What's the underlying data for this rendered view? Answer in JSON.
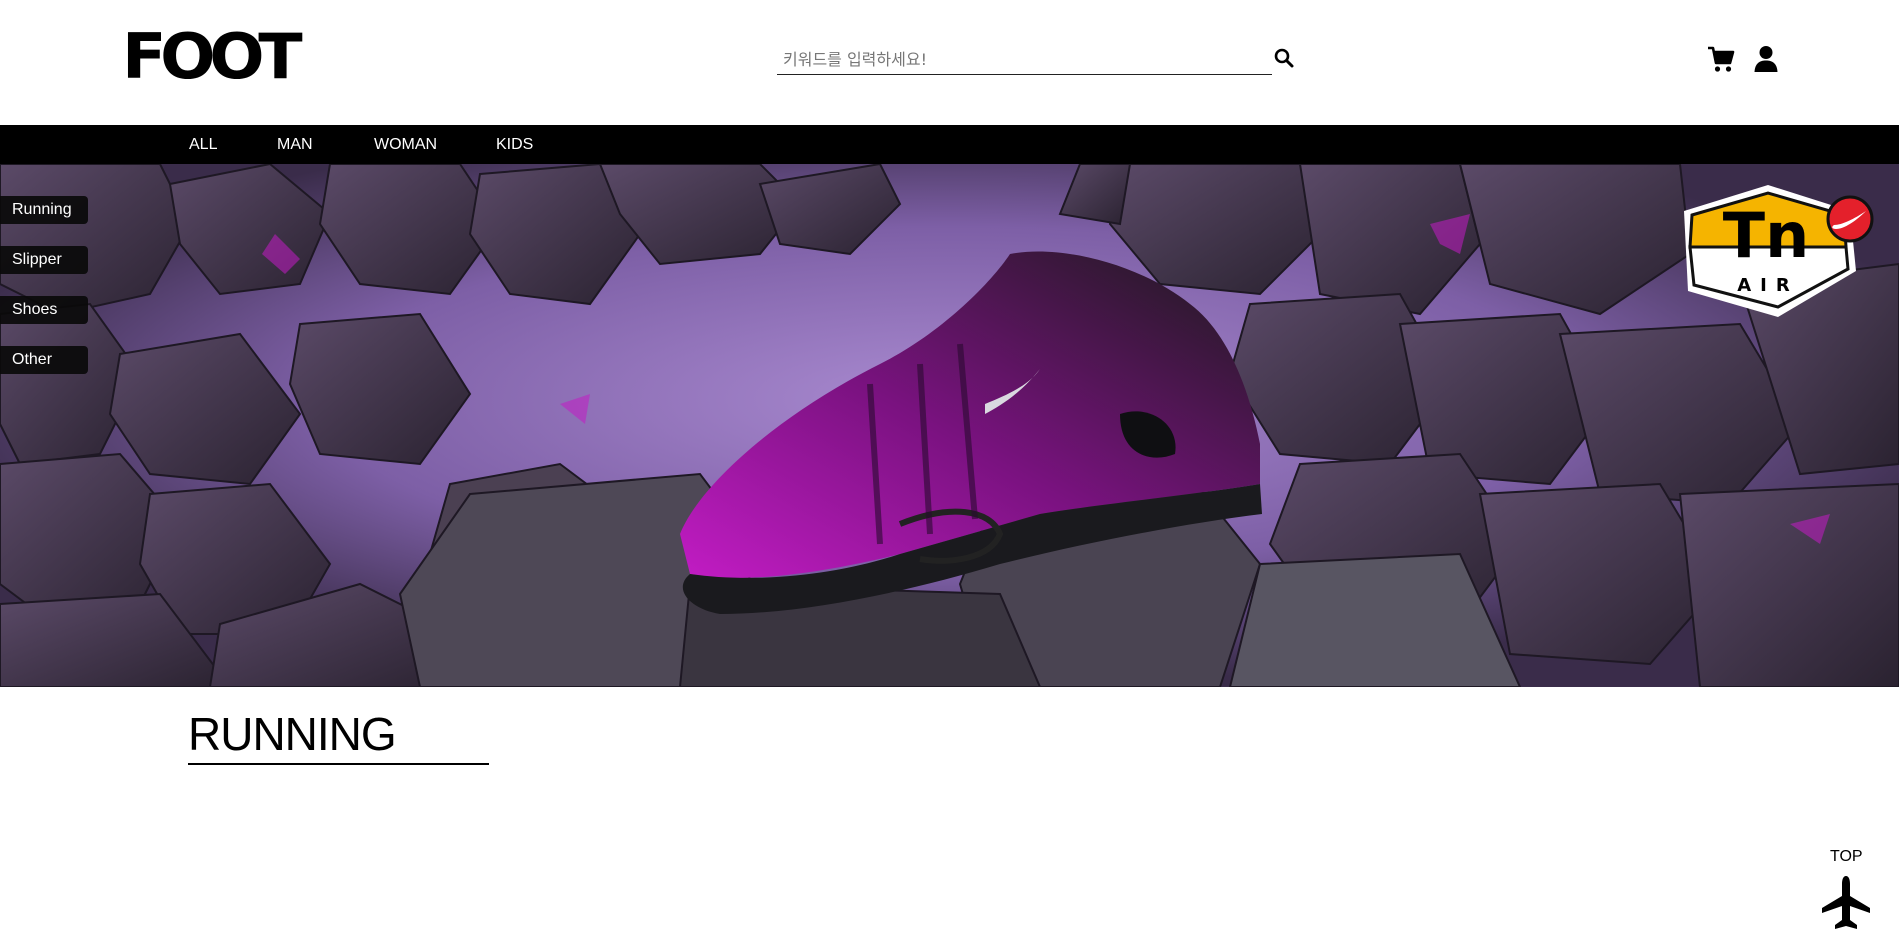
{
  "header": {
    "logo_text": "FOOT",
    "search": {
      "placeholder": "키워드를 입력하세요!",
      "value": ""
    },
    "icons": [
      "search-icon",
      "cart-icon",
      "user-icon"
    ]
  },
  "nav": {
    "items": [
      {
        "label": "ALL"
      },
      {
        "label": "MAN"
      },
      {
        "label": "WOMAN"
      },
      {
        "label": "KIDS"
      }
    ]
  },
  "side_menu": {
    "items": [
      {
        "label": "Running"
      },
      {
        "label": "Slipper"
      },
      {
        "label": "Shoes"
      },
      {
        "label": "Other"
      }
    ]
  },
  "hero": {
    "badge_text": "Tn",
    "badge_subtext": "AIR",
    "colors": {
      "background": "#6a4f86",
      "accent": "#c21cc4",
      "badge_yellow": "#f5b400",
      "swoosh_red": "#e4202b"
    }
  },
  "section": {
    "title": "RUNNING"
  },
  "top_button": {
    "label": "TOP",
    "icon": "airplane-icon"
  }
}
